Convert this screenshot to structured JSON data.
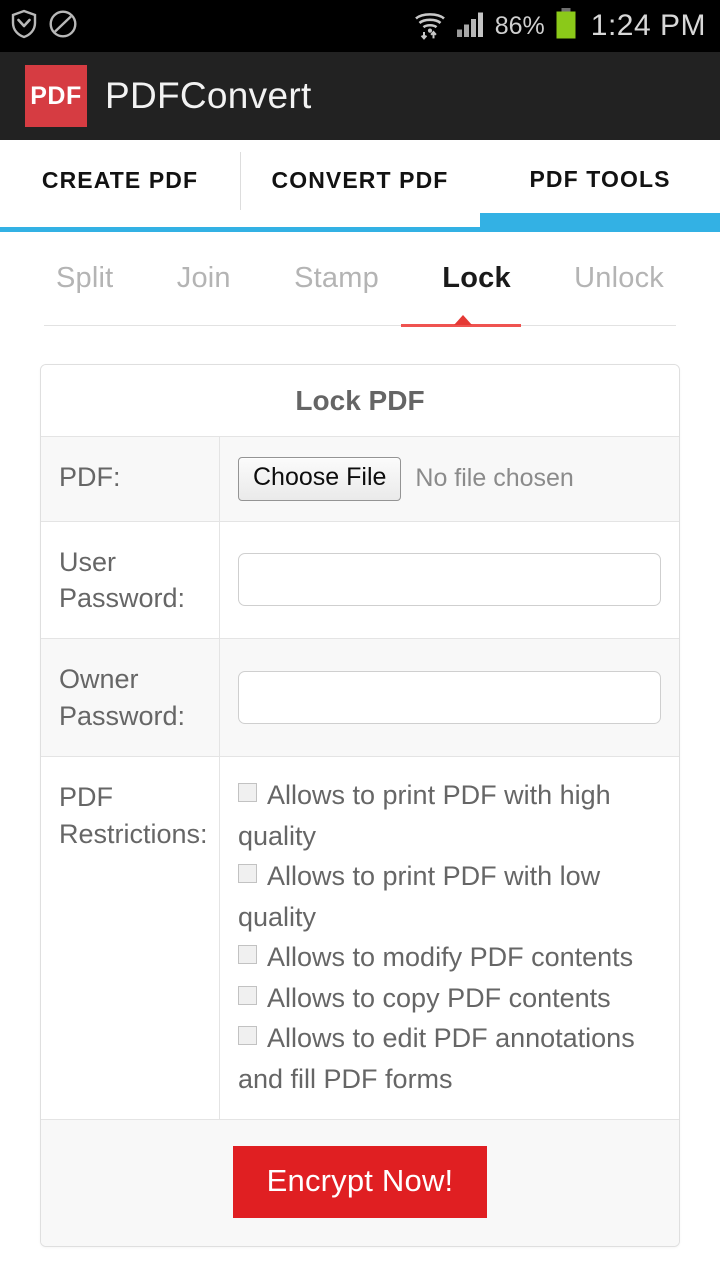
{
  "status_bar": {
    "icons_left": [
      "shield-down-icon",
      "do-not-disturb-icon"
    ],
    "wifi_icon": "wifi-data-icon",
    "signal_icon": "cellular-signal-icon",
    "battery_percent": "86%",
    "battery_icon": "battery-full-icon",
    "battery_color": "#8bc919",
    "clock": "1:24 PM"
  },
  "header": {
    "logo_text": "PDF",
    "logo_color": "#d63c42",
    "title": "PDFConvert"
  },
  "main_tabs": {
    "accent_color": "#33b1e4",
    "items": [
      {
        "label": "CREATE PDF",
        "active": false
      },
      {
        "label": "CONVERT PDF",
        "active": false
      },
      {
        "label": "PDF TOOLS",
        "active": true
      }
    ]
  },
  "sub_nav": {
    "indicator_color": "#e53935",
    "items": [
      {
        "label": "Split",
        "active": false
      },
      {
        "label": "Join",
        "active": false
      },
      {
        "label": "Stamp",
        "active": false
      },
      {
        "label": "Lock",
        "active": true
      },
      {
        "label": "Unlock",
        "active": false
      }
    ]
  },
  "card": {
    "title": "Lock PDF",
    "file_row": {
      "label": "PDF:",
      "button_label": "Choose File",
      "status_text": "No file chosen"
    },
    "user_password_row": {
      "label": "User Password:",
      "value": "",
      "placeholder": ""
    },
    "owner_password_row": {
      "label": "Owner Password:",
      "value": "",
      "placeholder": ""
    },
    "restrictions_row": {
      "label": "PDF Restrictions:",
      "options": [
        {
          "label": "Allows to print PDF with high quality",
          "checked": false
        },
        {
          "label": "Allows to print PDF with low quality",
          "checked": false
        },
        {
          "label": "Allows to modify PDF contents",
          "checked": false
        },
        {
          "label": "Allows to copy PDF contents",
          "checked": false
        },
        {
          "label": "Allows to edit PDF annotations and fill PDF forms",
          "checked": false
        }
      ]
    },
    "submit_label": "Encrypt Now!",
    "submit_color": "#e01f22"
  }
}
